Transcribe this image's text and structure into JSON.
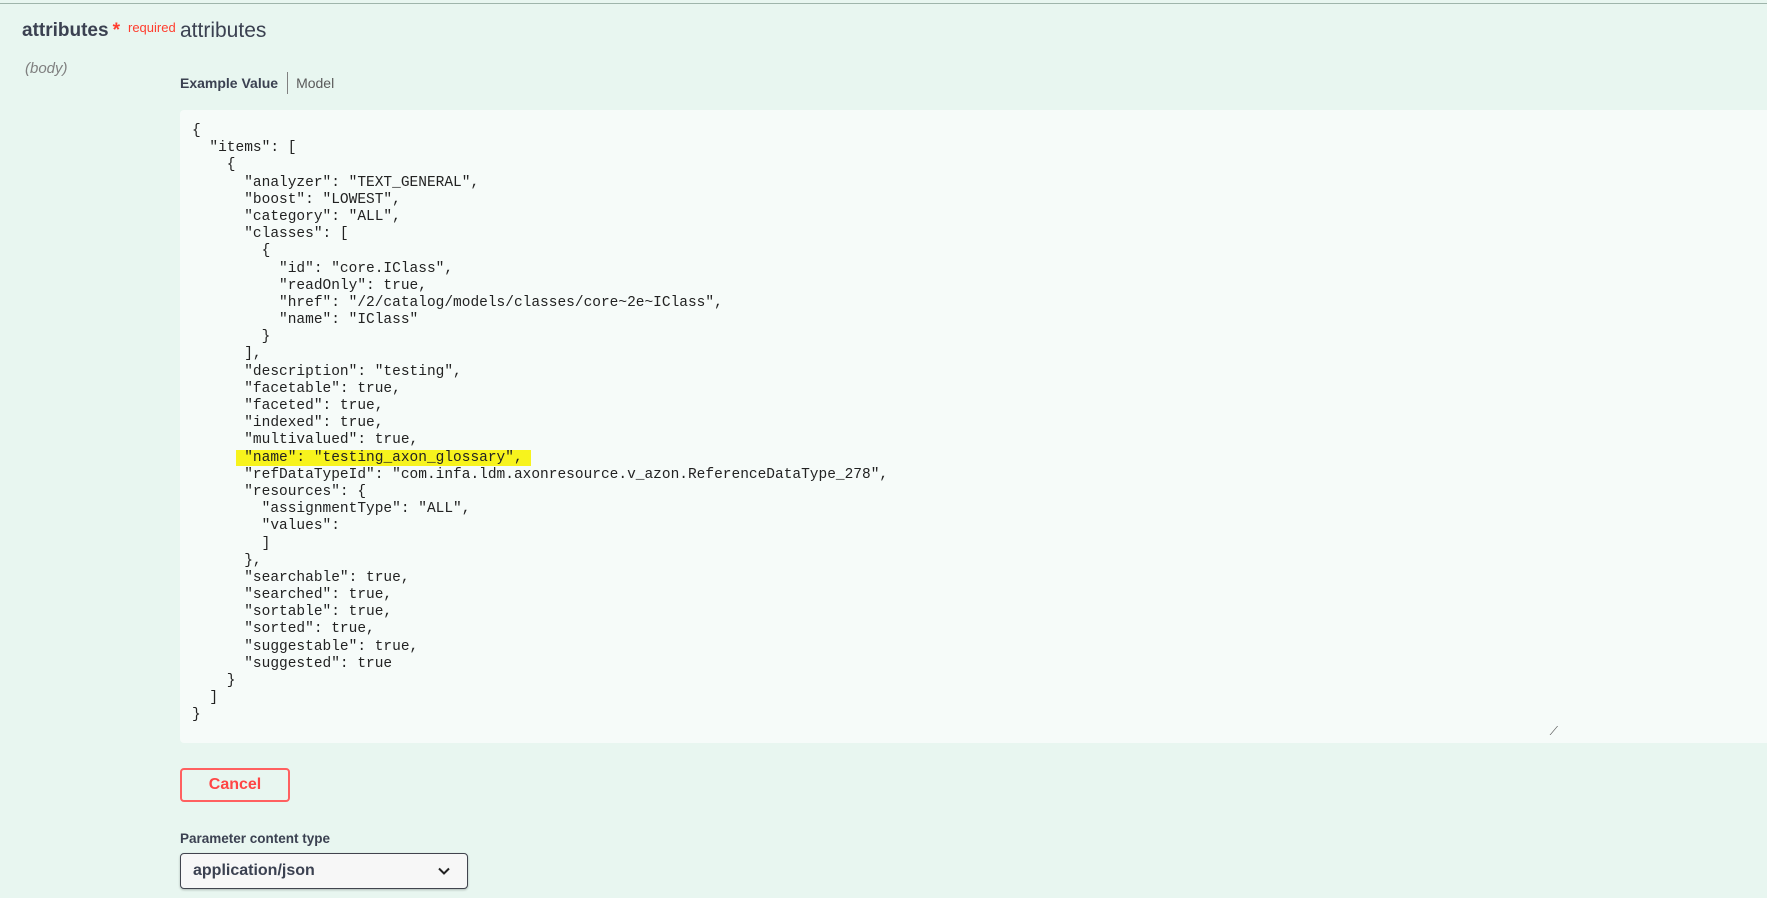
{
  "parameter": {
    "name": "attributes",
    "required_star": "*",
    "required_label": "required",
    "description": "attributes",
    "location": "(body)"
  },
  "tabs": {
    "example_value": "Example Value",
    "model": "Model"
  },
  "editor": {
    "highlighted_line_index": 19,
    "lines": [
      "{",
      "  \"items\": [",
      "    {",
      "      \"analyzer\": \"TEXT_GENERAL\",",
      "      \"boost\": \"LOWEST\",",
      "      \"category\": \"ALL\",",
      "      \"classes\": [",
      "        {",
      "          \"id\": \"core.IClass\",",
      "          \"readOnly\": true,",
      "          \"href\": \"/2/catalog/models/classes/core~2e~IClass\",",
      "          \"name\": \"IClass\"",
      "        }",
      "      ],",
      "      \"description\": \"testing\",",
      "      \"facetable\": true,",
      "      \"faceted\": true,",
      "      \"indexed\": true,",
      "      \"multivalued\": true,",
      "      \"name\": \"testing_axon_glossary\",",
      "      \"refDataTypeId\": \"com.infa.ldm.axonresource.v_azon.ReferenceDataType_278\",",
      "      \"resources\": {",
      "        \"assignmentType\": \"ALL\",",
      "        \"values\":",
      "        ]",
      "      },",
      "      \"searchable\": true,",
      "      \"searched\": true,",
      "      \"sortable\": true,",
      "      \"sorted\": true,",
      "      \"suggestable\": true,",
      "      \"suggested\": true",
      "    }",
      "  ]",
      "}"
    ]
  },
  "buttons": {
    "cancel": "Cancel"
  },
  "content_type": {
    "label": "Parameter content type",
    "selected": "application/json"
  },
  "colors": {
    "background": "#e8f6f0",
    "highlight": "#f7f31d",
    "cancel": "#ff4545",
    "required": "#ff3d2e"
  }
}
